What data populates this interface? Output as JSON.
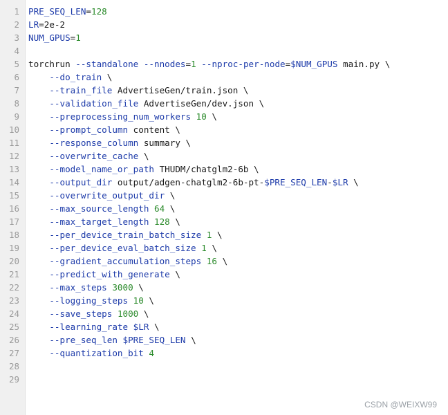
{
  "gutter": {
    "line_numbers": [
      "1",
      "2",
      "3",
      "4",
      "5",
      "6",
      "7",
      "8",
      "9",
      "10",
      "11",
      "12",
      "13",
      "14",
      "15",
      "16",
      "17",
      "18",
      "19",
      "20",
      "21",
      "22",
      "23",
      "24",
      "25",
      "26",
      "27",
      "28",
      "29"
    ]
  },
  "code": {
    "lines": [
      [
        {
          "t": "PRE_SEQ_LEN",
          "c": "var"
        },
        {
          "t": "=",
          "c": "txt"
        },
        {
          "t": "128",
          "c": "num"
        }
      ],
      [
        {
          "t": "LR",
          "c": "var"
        },
        {
          "t": "=2e-2",
          "c": "txt"
        }
      ],
      [
        {
          "t": "NUM_GPUS",
          "c": "var"
        },
        {
          "t": "=",
          "c": "txt"
        },
        {
          "t": "1",
          "c": "num"
        }
      ],
      [],
      [
        {
          "t": "torchrun ",
          "c": "cmd"
        },
        {
          "t": "--standalone",
          "c": "opt"
        },
        {
          "t": " ",
          "c": "txt"
        },
        {
          "t": "--nnodes",
          "c": "opt"
        },
        {
          "t": "=",
          "c": "txt"
        },
        {
          "t": "1",
          "c": "num"
        },
        {
          "t": " ",
          "c": "txt"
        },
        {
          "t": "--nproc-per-node",
          "c": "opt"
        },
        {
          "t": "=",
          "c": "txt"
        },
        {
          "t": "$NUM_GPUS",
          "c": "var"
        },
        {
          "t": " main.py \\",
          "c": "txt"
        }
      ],
      [
        {
          "t": "    ",
          "c": "txt"
        },
        {
          "t": "--do_train",
          "c": "opt"
        },
        {
          "t": " \\",
          "c": "txt"
        }
      ],
      [
        {
          "t": "    ",
          "c": "txt"
        },
        {
          "t": "--train_file",
          "c": "opt"
        },
        {
          "t": " AdvertiseGen/train.json \\",
          "c": "txt"
        }
      ],
      [
        {
          "t": "    ",
          "c": "txt"
        },
        {
          "t": "--validation_file",
          "c": "opt"
        },
        {
          "t": " AdvertiseGen/dev.json \\",
          "c": "txt"
        }
      ],
      [
        {
          "t": "    ",
          "c": "txt"
        },
        {
          "t": "--preprocessing_num_workers",
          "c": "opt"
        },
        {
          "t": " ",
          "c": "txt"
        },
        {
          "t": "10",
          "c": "num"
        },
        {
          "t": " \\",
          "c": "txt"
        }
      ],
      [
        {
          "t": "    ",
          "c": "txt"
        },
        {
          "t": "--prompt_column",
          "c": "opt"
        },
        {
          "t": " content \\",
          "c": "txt"
        }
      ],
      [
        {
          "t": "    ",
          "c": "txt"
        },
        {
          "t": "--response_column",
          "c": "opt"
        },
        {
          "t": " summary \\",
          "c": "txt"
        }
      ],
      [
        {
          "t": "    ",
          "c": "txt"
        },
        {
          "t": "--overwrite_cache",
          "c": "opt"
        },
        {
          "t": " \\",
          "c": "txt"
        }
      ],
      [
        {
          "t": "    ",
          "c": "txt"
        },
        {
          "t": "--model_name_or_path",
          "c": "opt"
        },
        {
          "t": " THUDM/chatglm2-6b \\",
          "c": "txt"
        }
      ],
      [
        {
          "t": "    ",
          "c": "txt"
        },
        {
          "t": "--output_dir",
          "c": "opt"
        },
        {
          "t": " output/adgen-chatglm2-6b-pt-",
          "c": "txt"
        },
        {
          "t": "$PRE_SEQ_LEN",
          "c": "var"
        },
        {
          "t": "-",
          "c": "txt"
        },
        {
          "t": "$LR",
          "c": "var"
        },
        {
          "t": " \\",
          "c": "txt"
        }
      ],
      [
        {
          "t": "    ",
          "c": "txt"
        },
        {
          "t": "--overwrite_output_dir",
          "c": "opt"
        },
        {
          "t": " \\",
          "c": "txt"
        }
      ],
      [
        {
          "t": "    ",
          "c": "txt"
        },
        {
          "t": "--max_source_length",
          "c": "opt"
        },
        {
          "t": " ",
          "c": "txt"
        },
        {
          "t": "64",
          "c": "num"
        },
        {
          "t": " \\",
          "c": "txt"
        }
      ],
      [
        {
          "t": "    ",
          "c": "txt"
        },
        {
          "t": "--max_target_length",
          "c": "opt"
        },
        {
          "t": " ",
          "c": "txt"
        },
        {
          "t": "128",
          "c": "num"
        },
        {
          "t": " \\",
          "c": "txt"
        }
      ],
      [
        {
          "t": "    ",
          "c": "txt"
        },
        {
          "t": "--per_device_train_batch_size",
          "c": "opt"
        },
        {
          "t": " ",
          "c": "txt"
        },
        {
          "t": "1",
          "c": "num"
        },
        {
          "t": " \\",
          "c": "txt"
        }
      ],
      [
        {
          "t": "    ",
          "c": "txt"
        },
        {
          "t": "--per_device_eval_batch_size",
          "c": "opt"
        },
        {
          "t": " ",
          "c": "txt"
        },
        {
          "t": "1",
          "c": "num"
        },
        {
          "t": " \\",
          "c": "txt"
        }
      ],
      [
        {
          "t": "    ",
          "c": "txt"
        },
        {
          "t": "--gradient_accumulation_steps",
          "c": "opt"
        },
        {
          "t": " ",
          "c": "txt"
        },
        {
          "t": "16",
          "c": "num"
        },
        {
          "t": " \\",
          "c": "txt"
        }
      ],
      [
        {
          "t": "    ",
          "c": "txt"
        },
        {
          "t": "--predict_with_generate",
          "c": "opt"
        },
        {
          "t": " \\",
          "c": "txt"
        }
      ],
      [
        {
          "t": "    ",
          "c": "txt"
        },
        {
          "t": "--max_steps",
          "c": "opt"
        },
        {
          "t": " ",
          "c": "txt"
        },
        {
          "t": "3000",
          "c": "num"
        },
        {
          "t": " \\",
          "c": "txt"
        }
      ],
      [
        {
          "t": "    ",
          "c": "txt"
        },
        {
          "t": "--logging_steps",
          "c": "opt"
        },
        {
          "t": " ",
          "c": "txt"
        },
        {
          "t": "10",
          "c": "num"
        },
        {
          "t": " \\",
          "c": "txt"
        }
      ],
      [
        {
          "t": "    ",
          "c": "txt"
        },
        {
          "t": "--save_steps",
          "c": "opt"
        },
        {
          "t": " ",
          "c": "txt"
        },
        {
          "t": "1000",
          "c": "num"
        },
        {
          "t": " \\",
          "c": "txt"
        }
      ],
      [
        {
          "t": "    ",
          "c": "txt"
        },
        {
          "t": "--learning_rate",
          "c": "opt"
        },
        {
          "t": " ",
          "c": "txt"
        },
        {
          "t": "$LR",
          "c": "var"
        },
        {
          "t": " \\",
          "c": "txt"
        }
      ],
      [
        {
          "t": "    ",
          "c": "txt"
        },
        {
          "t": "--pre_seq_len",
          "c": "opt"
        },
        {
          "t": " ",
          "c": "txt"
        },
        {
          "t": "$PRE_SEQ_LEN",
          "c": "var"
        },
        {
          "t": " \\",
          "c": "txt"
        }
      ],
      [
        {
          "t": "    ",
          "c": "txt"
        },
        {
          "t": "--quantization_bit",
          "c": "opt"
        },
        {
          "t": " ",
          "c": "txt"
        },
        {
          "t": "4",
          "c": "num"
        }
      ],
      [],
      []
    ]
  },
  "watermark": {
    "text": "CSDN @WEIXW99"
  },
  "colors": {
    "variable": "#1c3aa9",
    "number": "#2a8a2a",
    "text": "#1a1a1a",
    "gutter_bg": "#f0f0f0",
    "gutter_text": "#9a9a9a"
  }
}
